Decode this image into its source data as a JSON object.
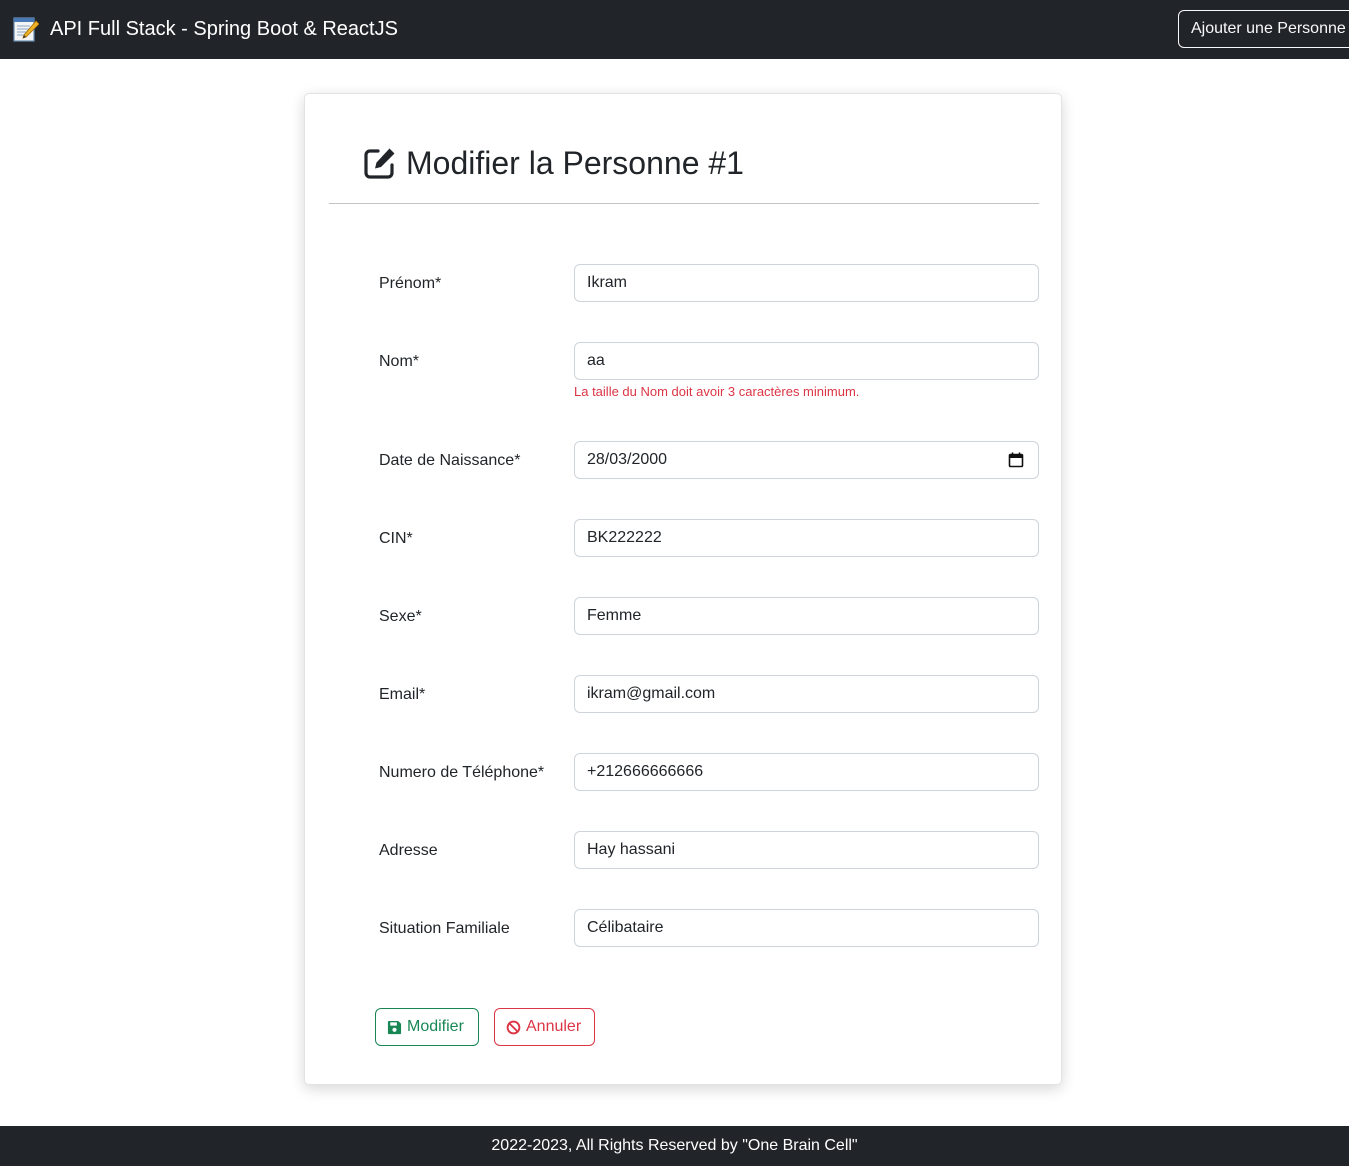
{
  "navbar": {
    "brand": "API Full Stack - Spring Boot & ReactJS",
    "brand_icon": "notepad-pencil-icon",
    "add_person_button": "Ajouter une Personne"
  },
  "card": {
    "title": "Modifier la Personne #1",
    "title_icon": "edit-icon"
  },
  "fields": [
    {
      "label": "Prénom*",
      "value": "Ikram"
    },
    {
      "label": "Nom*",
      "value": "aa",
      "error": "La taille du Nom doit avoir 3 caractères minimum."
    },
    {
      "label": "Date de Naissance*",
      "value": "28/03/2000",
      "icon": "calendar-icon"
    },
    {
      "label": "CIN*",
      "value": "BK222222"
    },
    {
      "label": "Sexe*",
      "value": "Femme"
    },
    {
      "label": "Email*",
      "value": "ikram@gmail.com"
    },
    {
      "label": "Numero de Téléphone*",
      "value": "+212666666666"
    },
    {
      "label": "Adresse",
      "value": "Hay hassani"
    },
    {
      "label": "Situation Familiale",
      "value": "Célibataire"
    }
  ],
  "buttons": {
    "submit": "Modifier",
    "submit_icon": "save-icon",
    "cancel": "Annuler",
    "cancel_icon": "ban-icon"
  },
  "footer": {
    "text": "2022-2023, All Rights Reserved by \"One Brain Cell\""
  },
  "colors": {
    "navbar_bg": "#212529",
    "success": "#198754",
    "danger": "#dc3545"
  }
}
